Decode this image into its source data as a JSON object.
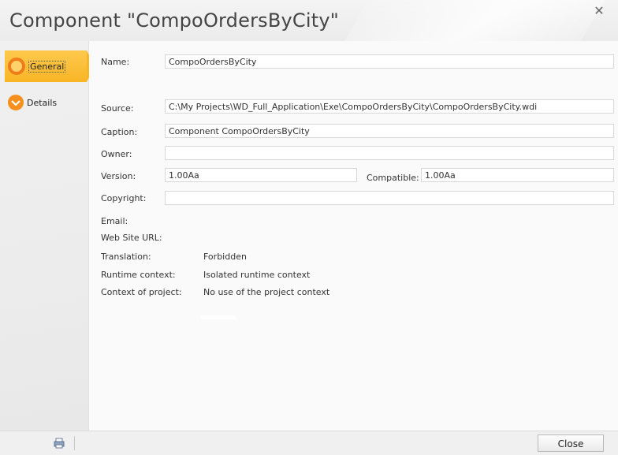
{
  "window": {
    "title": "Component \"CompoOrdersByCity\"",
    "close_glyph": "✕"
  },
  "sidebar": {
    "items": [
      {
        "label": "General",
        "icon": "ring-icon"
      },
      {
        "label": "Details",
        "icon": "chevron-down-icon"
      }
    ]
  },
  "form": {
    "name_label": "Name:",
    "name_value": "CompoOrdersByCity",
    "source_label": "Source:",
    "source_value": "C:\\My Projects\\WD_Full_Application\\Exe\\CompoOrdersByCity\\CompoOrdersByCity.wdi",
    "caption_label": "Caption:",
    "caption_value": "Component CompoOrdersByCity",
    "owner_label": "Owner:",
    "owner_value": "",
    "version_label": "Version:",
    "version_value": "1.00Aa",
    "compatible_label": "Compatible:",
    "compatible_value": "1.00Aa",
    "copyright_label": "Copyright:",
    "copyright_value": "",
    "email_label": "Email:",
    "website_label": "Web Site URL:",
    "translation_label": "Translation:",
    "translation_value": "Forbidden",
    "runtime_label": "Runtime context:",
    "runtime_value": "Isolated runtime context",
    "project_context_label": "Context of project:",
    "project_context_value": "No use of the project context"
  },
  "footer": {
    "close_label": "Close",
    "print_icon": "printer-icon"
  },
  "colors": {
    "accent": "#f8b526",
    "icon_orange": "#f07d1a"
  }
}
